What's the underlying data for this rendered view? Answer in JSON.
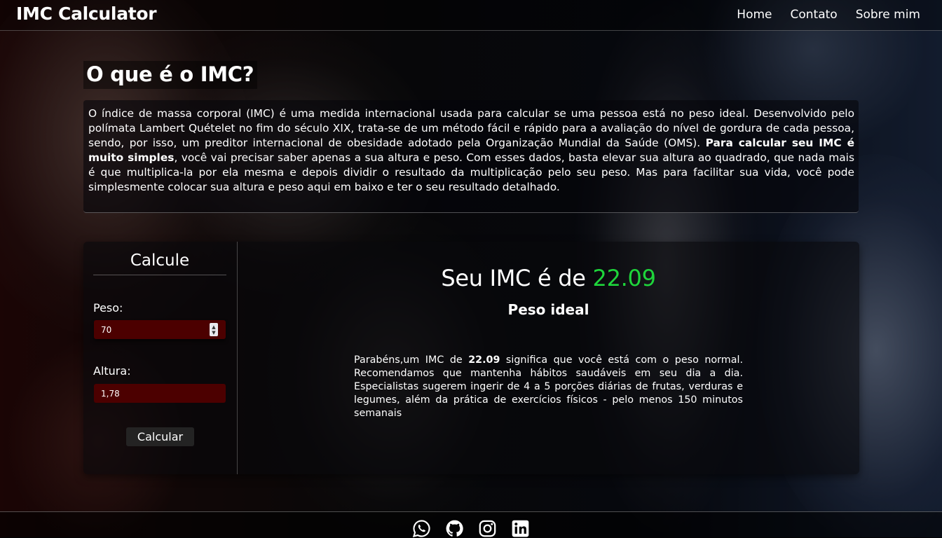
{
  "header": {
    "brand": "IMC Calculator",
    "nav": [
      "Home",
      "Contato",
      "Sobre mim"
    ]
  },
  "intro": {
    "title": "O que é o IMC?",
    "text_part1": "O índice de massa corporal (IMC) é uma medida internacional usada para calcular se uma pessoa está no peso ideal. Desenvolvido pelo polímata Lambert Quételet no fim do século XIX, trata-se de um método fácil e rápido para a avaliação do nível de gordura de cada pessoa, sendo, por isso, um preditor internacional de obesidade adotado pela Organização Mundial da Saúde (OMS). ",
    "text_bold": "Para calcular seu IMC é muito simples",
    "text_part2": ", você vai precisar saber apenas a sua altura e peso. Com esses dados, basta elevar sua altura ao quadrado, que nada mais é que multiplica-la por ela mesma e depois dividir o resultado da multiplicação pelo seu peso. Mas para facilitar sua vida, você pode simplesmente colocar sua altura e peso aqui em baixo e ter o seu resultado detalhado."
  },
  "calculator": {
    "title": "Calcule",
    "peso_label": "Peso:",
    "peso_value": "70",
    "altura_label": "Altura:",
    "altura_value": "1,78",
    "button_label": "Calcular"
  },
  "result": {
    "title_prefix": "Seu IMC é de ",
    "imc_value": "22.09",
    "status": "Peso ideal",
    "text_part1": "Parabéns,um IMC de ",
    "text_bold": "22.09",
    "text_part2": " significa que você está com o peso normal. Recomendamos que mantenha hábitos saudáveis em seu dia a dia. Especialistas sugerem ingerir de 4 a 5 porções diárias de frutas, verduras e legumes, além da prática de exercícios físicos - pelo menos 150 minutos semanais",
    "value_color": "#1ed53b"
  },
  "footer": {
    "social_icons": [
      "whatsapp-icon",
      "github-icon",
      "instagram-icon",
      "linkedin-icon"
    ]
  }
}
